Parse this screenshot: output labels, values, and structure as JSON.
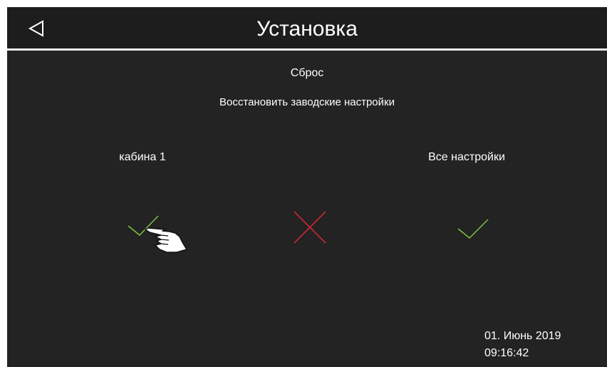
{
  "header": {
    "title": "Установка",
    "back_icon": "back-triangle-icon"
  },
  "main": {
    "section_title": "Сброс",
    "subtitle": "Восстановить заводские настройки",
    "options": [
      {
        "label": "кабина 1",
        "action_icon": "checkmark-icon"
      },
      {
        "label": "Все настройки",
        "action_icon": "checkmark-icon"
      }
    ],
    "cancel_icon": "cross-icon"
  },
  "footer": {
    "date": "01. Июнь 2019",
    "time": "09:16:42"
  },
  "colors": {
    "background": "#232323",
    "header_background": "#1d1d1d",
    "divider": "#f2f2f2",
    "confirm": "#7cc142",
    "cancel": "#e0283a",
    "text": "#ffffff"
  },
  "cursor_icon": "hand-pointer-icon"
}
